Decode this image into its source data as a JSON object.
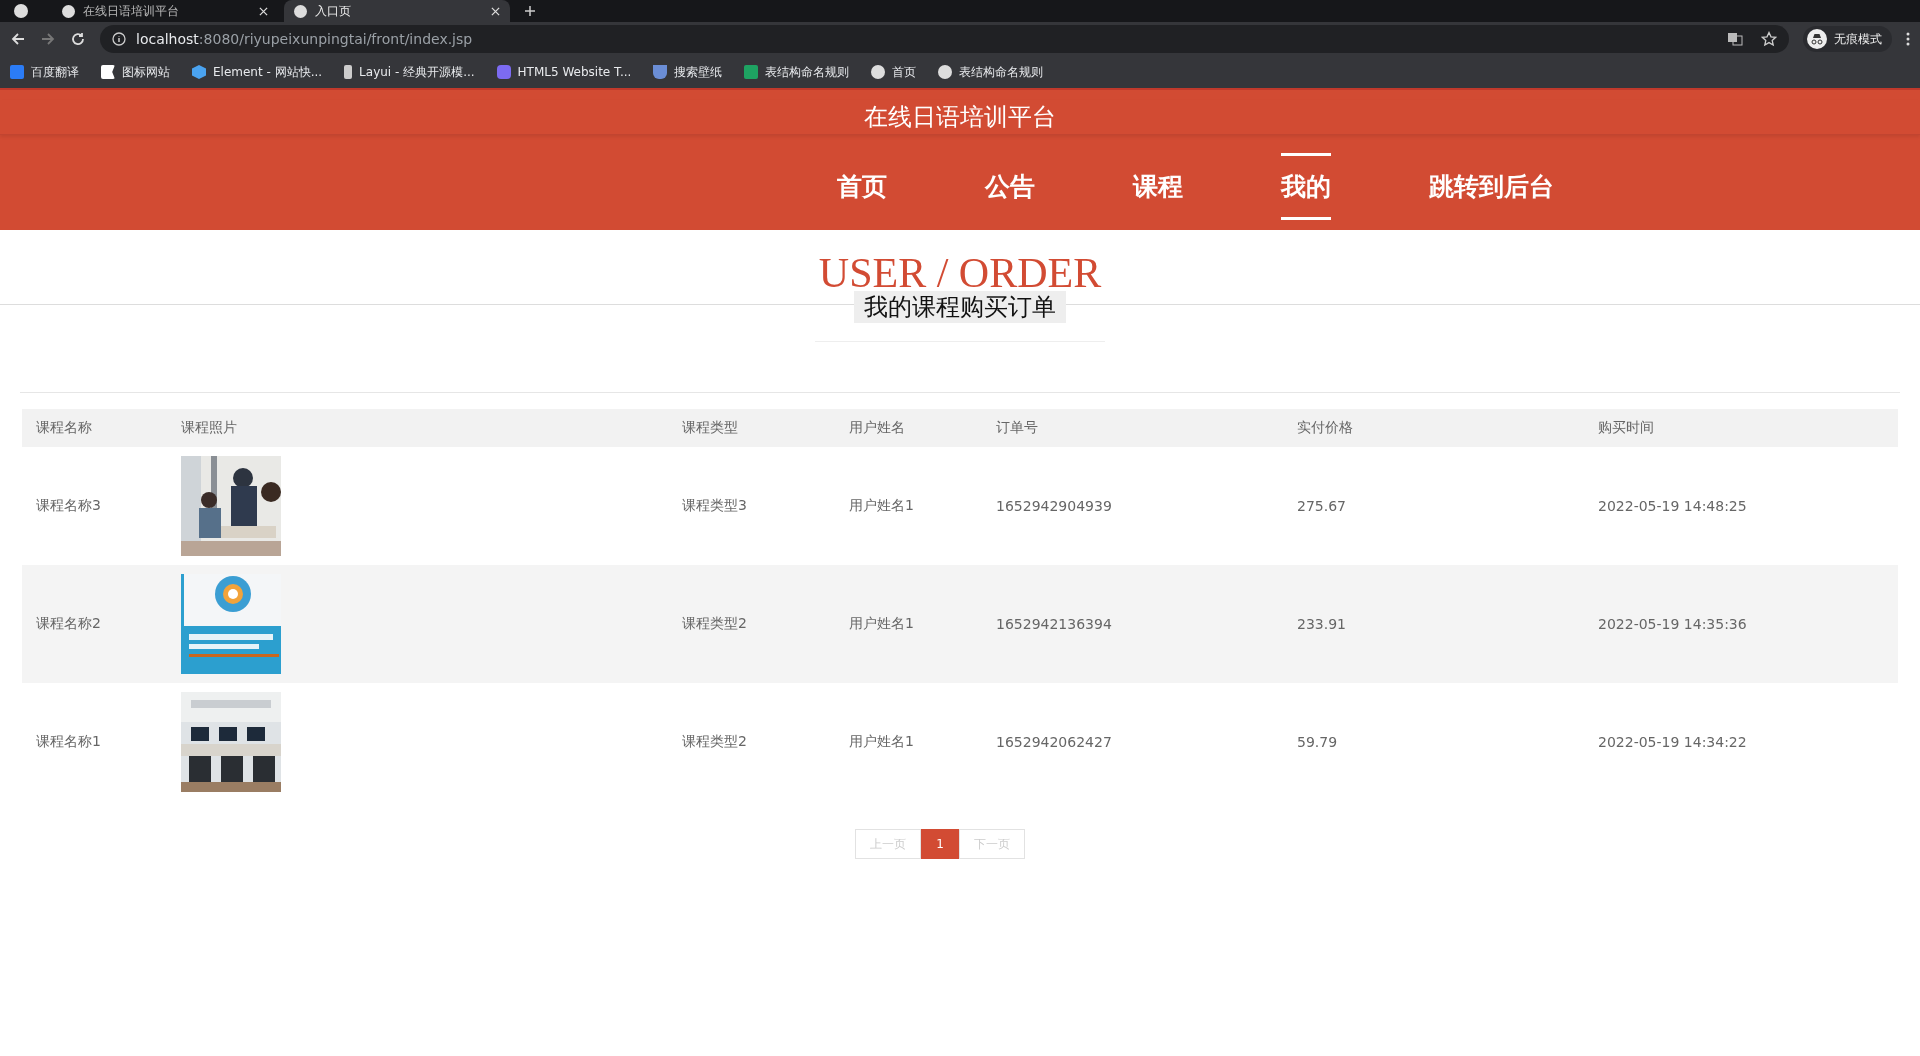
{
  "browser": {
    "tabs": [
      {
        "title": "在线日语培训平台",
        "selected": false
      },
      {
        "title": "入口页",
        "selected": true
      }
    ],
    "address": {
      "host": "localhost",
      "rest": ":8080/riyupeixunpingtai/front/index.jsp"
    },
    "bookmarks": [
      {
        "label": "百度翻译",
        "kind": "translate"
      },
      {
        "label": "图标网站",
        "kind": "flag"
      },
      {
        "label": "Element - 网站快...",
        "kind": "hex"
      },
      {
        "label": "Layui - 经典开源模...",
        "kind": "layui"
      },
      {
        "label": "HTML5 Website T...",
        "kind": "html5"
      },
      {
        "label": "搜索壁纸",
        "kind": "wall"
      },
      {
        "label": "表结构命名规则",
        "kind": "sheet"
      },
      {
        "label": "首页",
        "kind": "globe"
      },
      {
        "label": "表结构命名规则",
        "kind": "globe"
      }
    ],
    "profile": "无痕模式"
  },
  "site_title": "在线日语培训平台",
  "nav": [
    {
      "label": "首页",
      "selected": false
    },
    {
      "label": "公告",
      "selected": false
    },
    {
      "label": "课程",
      "selected": false
    },
    {
      "label": "我的",
      "selected": true
    },
    {
      "label": "跳转到后台",
      "selected": false
    }
  ],
  "heading": "USER / ORDER",
  "subheading": "我的课程购买订单",
  "table": {
    "columns": [
      "课程名称",
      "课程照片",
      "课程类型",
      "用户姓名",
      "订单号",
      "实付价格",
      "购买时间"
    ],
    "rows": [
      {
        "name": "课程名称3",
        "type": "课程类型3",
        "user": "用户姓名1",
        "order_no": "1652942904939",
        "price": "275.67",
        "time": "2022-05-19 14:48:25"
      },
      {
        "name": "课程名称2",
        "type": "课程类型2",
        "user": "用户姓名1",
        "order_no": "1652942136394",
        "price": "233.91",
        "time": "2022-05-19 14:35:36"
      },
      {
        "name": "课程名称1",
        "type": "课程类型2",
        "user": "用户姓名1",
        "order_no": "1652942062427",
        "price": "59.79",
        "time": "2022-05-19 14:34:22"
      }
    ]
  },
  "pagination": {
    "prev": "上一页",
    "pages": [
      {
        "label": "1",
        "selected": true
      }
    ],
    "next": "下一页"
  }
}
